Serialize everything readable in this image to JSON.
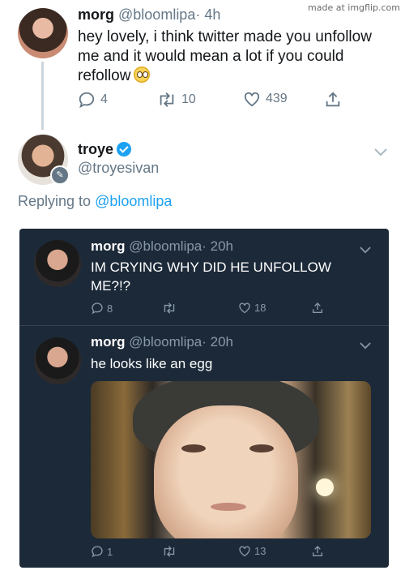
{
  "watermark": "made at imgflip.com",
  "top_tweet": {
    "name": "morg",
    "handle": "@bloomlipa",
    "time": "· 4h",
    "text": "hey lovely, i think twitter made you unfollow me and it would mean a lot if you could refollow",
    "emoji": "pleading-face",
    "replies": "4",
    "retweets": "10",
    "likes": "439"
  },
  "reply_tweet": {
    "name": "troye",
    "handle": "@troyesivan",
    "replying_prefix": "Replying to",
    "replying_to": "@bloomlipa"
  },
  "embedded": {
    "tweets": [
      {
        "name": "morg",
        "handle": "@bloomlipa",
        "time": "· 20h",
        "text": "IM CRYING WHY DID HE UNFOLLOW ME?!?",
        "replies": "8",
        "retweets": "",
        "likes": "18"
      },
      {
        "name": "morg",
        "handle": "@bloomlipa",
        "time": "· 20h",
        "text": "he looks like an egg",
        "replies": "1",
        "retweets": "",
        "likes": "13"
      }
    ]
  },
  "colors": {
    "accent": "#1da1f2",
    "dark_bg": "#1c2938",
    "muted": "#657786"
  }
}
